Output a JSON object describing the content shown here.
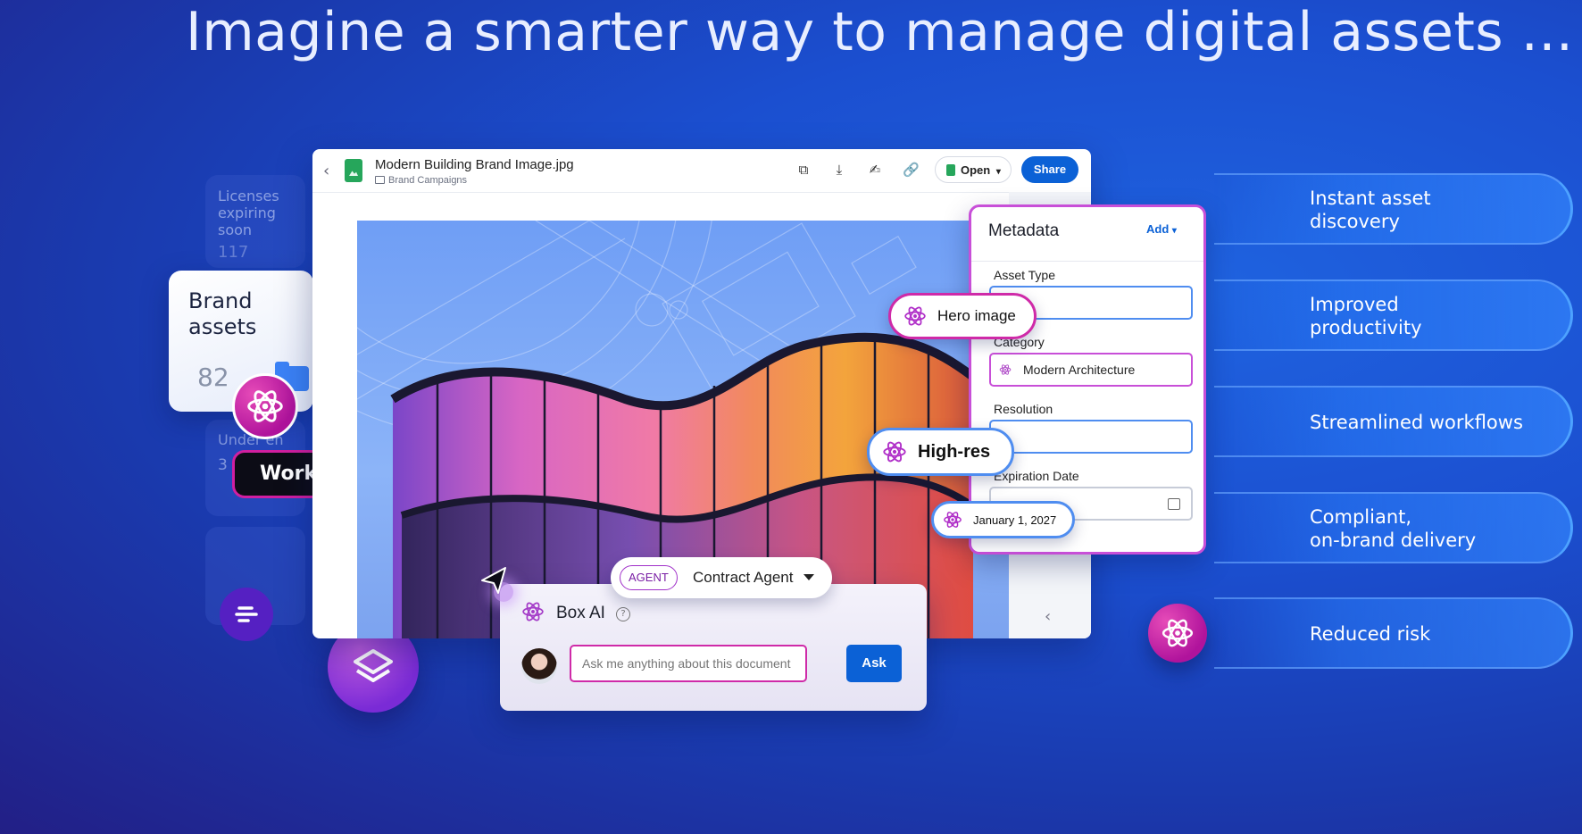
{
  "headline": "Imagine a smarter way to manage digital assets ...",
  "side_cards": {
    "licenses_label": "Licenses expiring soon",
    "licenses_count": "117",
    "under_label": "Under en",
    "under_count": "3"
  },
  "brand_card": {
    "title": "Brand assets",
    "count": "82"
  },
  "workflow_label": "Workflow initiated",
  "viewer": {
    "file_name": "Modern Building Brand Image.jpg",
    "folder": "Brand Campaigns",
    "open_label": "Open",
    "share_label": "Share",
    "toolbar_icons": [
      "copy-icon",
      "download-icon",
      "sign-icon",
      "link-icon"
    ]
  },
  "metadata": {
    "title": "Metadata",
    "add_label": "Add",
    "fields": [
      {
        "label": "Asset Type",
        "value": ""
      },
      {
        "label": "Category",
        "value": "Modern Architecture"
      },
      {
        "label": "Resolution",
        "value": ""
      },
      {
        "label": "Expiration Date",
        "value": ""
      }
    ]
  },
  "ai_chips": {
    "hero": "Hero image",
    "highres": "High-res",
    "date": "January 1, 2027"
  },
  "agent": {
    "badge": "AGENT",
    "name": "Contract Agent"
  },
  "box_ai": {
    "title": "Box AI",
    "help": "?",
    "placeholder": "Ask me anything about this document",
    "ask_label": "Ask"
  },
  "benefits": [
    "Instant asset\ndiscovery",
    "Improved\nproductivity",
    "Streamlined workflows",
    "Compliant,\non-brand delivery",
    "Reduced risk"
  ],
  "colors": {
    "accent_blue": "#0b61d6",
    "ai_magenta": "#cf2aa8",
    "ai_purple": "#7a2bd6"
  }
}
